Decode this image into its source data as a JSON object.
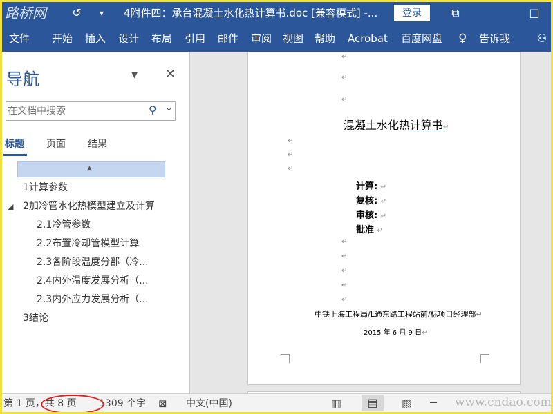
{
  "titlebar": {
    "logo_text": "路桥网",
    "undo_icon": "↺",
    "qat_icon": "▾",
    "title": "4附件四：承台混凝土水化热计算书.doc [兼容模式] -...",
    "login_label": "登录",
    "restore_icon": "⧉",
    "close_icon": "□"
  },
  "ribbon": {
    "tabs": [
      "文件",
      "开始",
      "插入",
      "设计",
      "布局",
      "引用",
      "邮件",
      "审阅",
      "视图",
      "帮助",
      "Acrobat",
      "百度网盘"
    ],
    "tell_me_icon": "♀",
    "tell_me": "告诉我",
    "share_icon": "⚇"
  },
  "nav": {
    "title": "导航",
    "dropdown_icon": "▼",
    "close_icon": "✕",
    "search_placeholder": "在文档中搜索",
    "search_icon": "⚲",
    "search_dropdown_icon": "⌄",
    "tabs": [
      "标题",
      "页面",
      "结果"
    ],
    "scroll_up_icon": "▲",
    "expand_icon": "◢",
    "headings": [
      "1计算参数",
      "2加冷管水化热模型建立及计算",
      "2.1冷管参数",
      "2.2布置冷却管模型计算",
      "2.3各阶段温度分部（冷...",
      "2.4内外温度发展分析（...",
      "2.3内外应力发展分析（...",
      "3结论"
    ]
  },
  "doc": {
    "para_mark": "↵",
    "title_main": "混凝土水化热",
    "title_underlined": "计算书",
    "signatures": [
      "计算:",
      "复核:",
      "审核:",
      "批准"
    ],
    "org": "中铁上海工程局∕L通东路工程站前∕标项目经理部",
    "date": "2015 年 6 月 9 日"
  },
  "status": {
    "page": "第 1 页，共 8 页",
    "words": "1309 个字",
    "proof_icon": "⊠",
    "language": "中文(中国)",
    "read_icon": "▥",
    "print_icon": "▤",
    "web_icon": "▧",
    "zoom_out": "－",
    "watermark": "www.cndao.com"
  }
}
